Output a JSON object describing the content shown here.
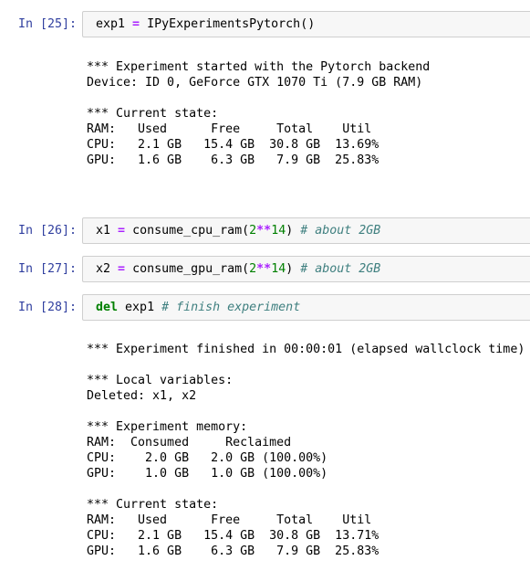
{
  "cells": [
    {
      "prompt": "In [25]:",
      "code": {
        "name": "exp1",
        "op": "=",
        "call": "IPyExperimentsPytorch()"
      }
    },
    {
      "prompt": "In [26]:",
      "code": {
        "name": "x1",
        "op": "=",
        "fn": "consume_cpu_ram(",
        "num1": "2",
        "pow": "**",
        "num2": "14",
        "close": ")",
        "comment": "# about 2GB"
      }
    },
    {
      "prompt": "In [27]:",
      "code": {
        "name": "x2",
        "op": "=",
        "fn": "consume_gpu_ram(",
        "num1": "2",
        "pow": "**",
        "num2": "14",
        "close": ")",
        "comment": "# about 2GB"
      }
    },
    {
      "prompt": "In [28]:",
      "code": {
        "keyword": "del",
        "name": "exp1",
        "comment": "# finish experiment"
      }
    }
  ],
  "outputs": {
    "out25": "*** Experiment started with the Pytorch backend\nDevice: ID 0, GeForce GTX 1070 Ti (7.9 GB RAM)\n\n*** Current state:\nRAM:   Used      Free     Total    Util\nCPU:   2.1 GB   15.4 GB  30.8 GB  13.69%\nGPU:   1.6 GB    6.3 GB   7.9 GB  25.83%",
    "out28": "*** Experiment finished in 00:00:01 (elapsed wallclock time)\n\n*** Local variables:\nDeleted: x1, x2\n\n*** Experiment memory:\nRAM:  Consumed     Reclaimed\nCPU:    2.0 GB   2.0 GB (100.00%)\nGPU:    1.0 GB   1.0 GB (100.00%)\n\n*** Current state:\nRAM:   Used      Free     Total    Util\nCPU:   2.1 GB   15.4 GB  30.8 GB  13.71%\nGPU:   1.6 GB    6.3 GB   7.9 GB  25.83%"
  }
}
